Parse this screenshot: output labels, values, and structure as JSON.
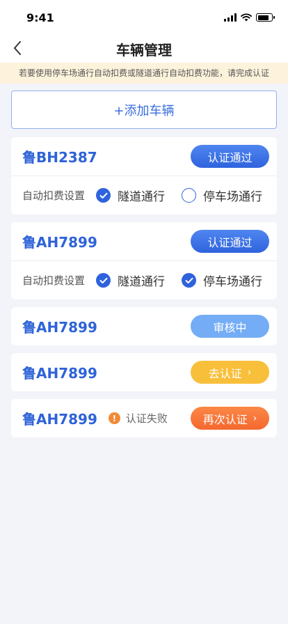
{
  "status_bar": {
    "time": "9:41"
  },
  "nav": {
    "title": "车辆管理"
  },
  "notice": "若要使用停车场通行自动扣费或隧道通行自动扣费功能，请完成认证",
  "add_button": "+添加车辆",
  "settings_label": "自动扣费设置",
  "options": {
    "tunnel": "隧道通行",
    "parking": "停车场通行"
  },
  "vehicles": [
    {
      "plate": "鲁BH2387",
      "status": "认证通过",
      "tunnel_checked": true,
      "parking_checked": false
    },
    {
      "plate": "鲁AH7899",
      "status": "认证通过",
      "tunnel_checked": true,
      "parking_checked": true
    },
    {
      "plate": "鲁AH7899",
      "status": "审核中"
    },
    {
      "plate": "鲁AH7899",
      "status": "去认证"
    },
    {
      "plate": "鲁AH7899",
      "status": "再次认证",
      "note": "认证失败"
    }
  ],
  "colors": {
    "primary": "#2f63dd",
    "review": "#74acf5",
    "pending": "#f8bf3a",
    "failed": "#f4682f",
    "notice_bg": "#fdf3dc"
  },
  "icons": [
    "back-arrow-icon",
    "signal-icon",
    "wifi-icon",
    "battery-icon",
    "check-icon",
    "chevron-right-icon",
    "warning-icon"
  ]
}
